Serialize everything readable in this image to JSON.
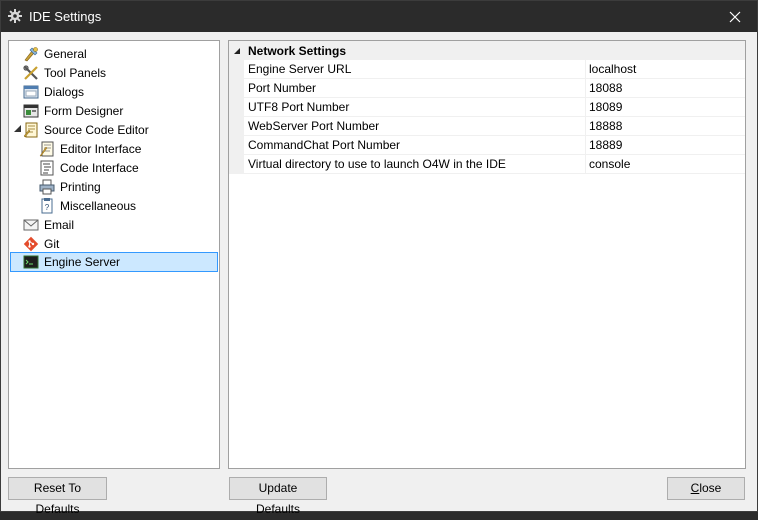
{
  "window": {
    "title": "IDE Settings"
  },
  "tree": {
    "items": [
      {
        "label": "General",
        "icon": "general-icon"
      },
      {
        "label": "Tool Panels",
        "icon": "tools-icon"
      },
      {
        "label": "Dialogs",
        "icon": "dialog-icon"
      },
      {
        "label": "Form Designer",
        "icon": "form-designer-icon"
      },
      {
        "label": "Source Code Editor",
        "icon": "source-code-icon",
        "expanded": true
      },
      {
        "label": "Editor Interface",
        "icon": "editor-icon"
      },
      {
        "label": "Code Interface",
        "icon": "code-icon"
      },
      {
        "label": "Printing",
        "icon": "printer-icon"
      },
      {
        "label": "Miscellaneous",
        "icon": "misc-icon"
      },
      {
        "label": "Email",
        "icon": "email-icon"
      },
      {
        "label": "Git",
        "icon": "git-icon"
      },
      {
        "label": "Engine Server",
        "icon": "terminal-icon",
        "selected": true
      }
    ]
  },
  "grid": {
    "category": "Network Settings",
    "rows": [
      {
        "name": "Engine Server URL",
        "value": "localhost"
      },
      {
        "name": "Port Number",
        "value": "18088"
      },
      {
        "name": "UTF8 Port Number",
        "value": "18089"
      },
      {
        "name": "WebServer Port Number",
        "value": "18888"
      },
      {
        "name": "CommandChat Port Number",
        "value": "18889"
      },
      {
        "name": "Virtual directory to use to launch O4W in the IDE",
        "value": "console"
      }
    ]
  },
  "buttons": {
    "reset": "Reset To Defaults",
    "update": "Update Defaults",
    "close_mnemonic": "C",
    "close_rest": "lose"
  }
}
